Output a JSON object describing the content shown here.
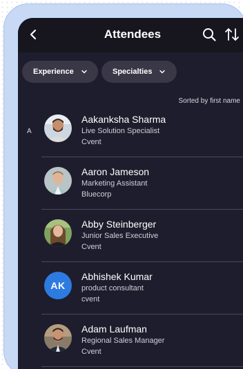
{
  "header": {
    "title": "Attendees",
    "back_icon": "chevron-left-icon",
    "search_icon": "search-icon",
    "sort_icon": "sort-arrows-icon"
  },
  "filters": {
    "experience_label": "Experience",
    "specialties_label": "Specialties"
  },
  "list": {
    "sort_note": "Sorted by first name",
    "section_letter": "A",
    "attendees": [
      {
        "name": "Aakanksha Sharma",
        "role": "Live Solution Specialist",
        "company": "Cvent"
      },
      {
        "name": "Aaron Jameson",
        "role": "Marketing Assistant",
        "company": "Bluecorp"
      },
      {
        "name": "Abby Steinberger",
        "role": "Junior Sales Executive",
        "company": "Cvent"
      },
      {
        "name": "Abhishek Kumar",
        "role": "product consultant",
        "company": "cvent",
        "initials": "AK"
      },
      {
        "name": "Adam Laufman",
        "role": "Regional Sales Manager",
        "company": "Cvent"
      }
    ]
  },
  "colors": {
    "screen_bg": "#1e1d2d",
    "header_bg": "#17161f",
    "chip_bg": "#3a3847",
    "initials_avatar": "#2d7be0",
    "device_frame": "#c7d9f5"
  }
}
